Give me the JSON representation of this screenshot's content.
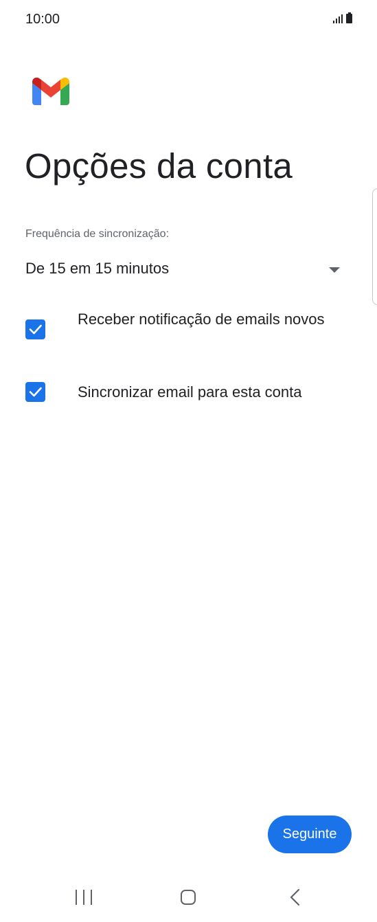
{
  "status_bar": {
    "time": "10:00",
    "icons": [
      "signal-icon",
      "battery-icon"
    ]
  },
  "app": {
    "logo": "gmail-logo",
    "brand_colors": {
      "blue": "#4285F4",
      "red": "#EA4335",
      "yellow": "#FBBC04",
      "green": "#34A853",
      "dark_red": "#C5221F"
    }
  },
  "page": {
    "title": "Opções da conta"
  },
  "sync": {
    "label": "Frequência de sincronização:",
    "selected_value": "De 15 em 15 minutos",
    "icon": "dropdown-arrow-icon"
  },
  "options": [
    {
      "label": "Receber notificação de emails novos",
      "checked": true
    },
    {
      "label": "Sincronizar email para esta conta",
      "checked": true
    }
  ],
  "actions": {
    "next_label": "Seguinte"
  },
  "nav_bar": {
    "icons": [
      "recent-apps-icon",
      "home-icon",
      "back-icon"
    ]
  },
  "colors": {
    "accent": "#1a73e8",
    "text_primary": "#202124",
    "text_secondary": "#5f6368",
    "background": "#ffffff"
  }
}
